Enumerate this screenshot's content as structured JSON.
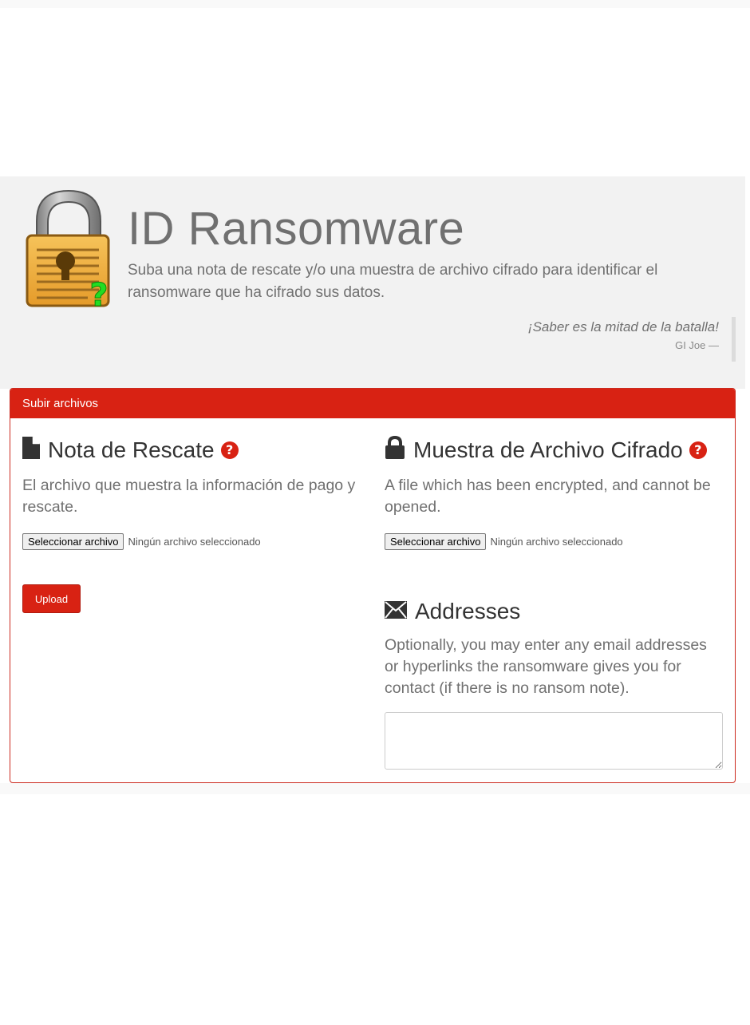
{
  "hero": {
    "title": "ID Ransomware",
    "subtitle": "Suba una nota de rescate y/o una muestra de archivo cifrado para identificar el ransomware que ha cifrado sus datos.",
    "quote": "¡Saber es la mitad de la batalla!",
    "quote_author": "GI Joe —",
    "logo_icon": "padlock-question-icon"
  },
  "panel": {
    "heading": "Subir archivos",
    "ransom_note": {
      "title": "Nota de Rescate",
      "icon": "file-icon",
      "help_icon": "question-circle-icon",
      "description": "El archivo que muestra la información de pago y rescate.",
      "file_button": "Seleccionar archivo",
      "file_status": "Ningún archivo seleccionado"
    },
    "encrypted_sample": {
      "title": "Muestra de Archivo Cifrado",
      "icon": "lock-icon",
      "help_icon": "question-circle-icon",
      "description": "A file which has been encrypted, and cannot be opened.",
      "file_button": "Seleccionar archivo",
      "file_status": "Ningún archivo seleccionado"
    },
    "addresses": {
      "title": "Addresses",
      "icon": "envelope-icon",
      "description": "Optionally, you may enter any email addresses or hyperlinks the ransomware gives you for contact (if there is no ransom note).",
      "value": ""
    },
    "upload_label": "Upload"
  },
  "colors": {
    "accent": "#d82213",
    "hero_bg": "#f2f2f2",
    "muted_text": "#707070"
  }
}
